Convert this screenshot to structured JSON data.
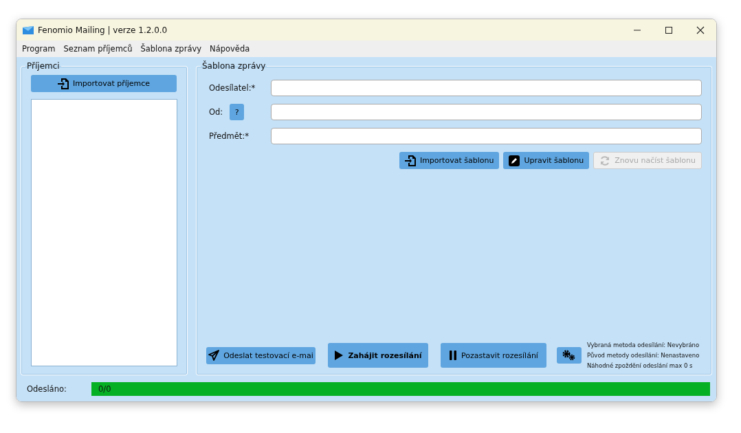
{
  "window": {
    "title": "Fenomio Mailing | verze 1.2.0.0"
  },
  "menu": [
    "Program",
    "Seznam příjemců",
    "Šablona zprávy",
    "Nápověda"
  ],
  "recipients": {
    "title": "Příjemci",
    "import_button": "Importovat příjemce"
  },
  "template": {
    "title": "Šablona zprávy",
    "fields": [
      {
        "label": "Odesílatel:*"
      },
      {
        "label": "Od:",
        "help": "?"
      },
      {
        "label": "Předmět:*"
      }
    ],
    "buttons": [
      {
        "label": "Importovat šablonu",
        "disabled": false
      },
      {
        "label": "Upravit šablonu",
        "disabled": false
      },
      {
        "label": "Znovu načíst šablonu",
        "disabled": true
      }
    ],
    "actions": [
      {
        "label": "Odeslat testovací e-mai",
        "primary": false
      },
      {
        "label": "Zahájit rozesílání",
        "primary": true
      },
      {
        "label": "Pozastavit rozesílání",
        "primary": false
      }
    ],
    "info": [
      "Vybraná metoda odesílání: Nevybráno",
      "Původ metody odesílání: Nenastaveno",
      "Náhodné zpoždění odeslání max 0 s"
    ]
  },
  "status": {
    "label": "Odesláno:",
    "progress_text": "0/0",
    "level": 1
  }
}
